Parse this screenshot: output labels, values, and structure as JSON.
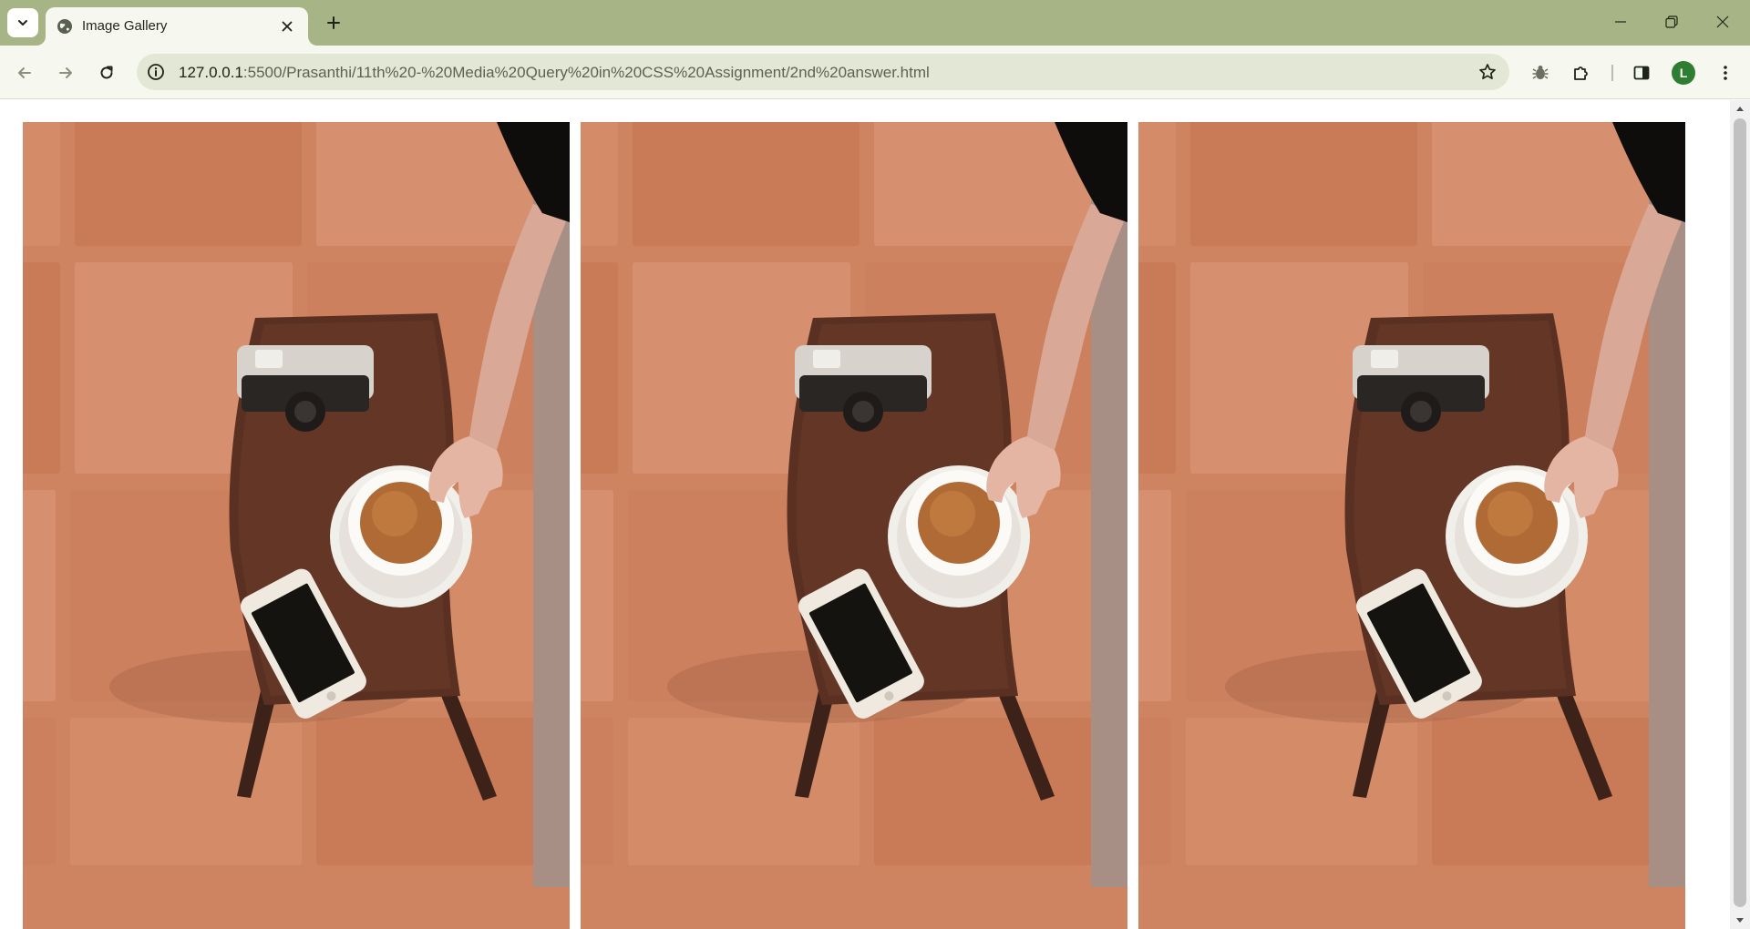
{
  "browser": {
    "tab": {
      "title": "Image Gallery",
      "favicon": "globe-icon"
    },
    "address_bar": {
      "host": "127.0.0.1",
      "rest": ":5500/Prasanthi/11th%20-%20Media%20Query%20in%20CSS%20Assignment/2nd%20answer.html"
    },
    "profile_initial": "L",
    "colors": {
      "frame": "#a7b485",
      "toolbar": "#f6f8ef",
      "omnibox": "#e3e7d6",
      "profile": "#2e7d32"
    }
  },
  "gallery": {
    "images": [
      {
        "subject": "tea-cup-camera-phone-on-stool"
      },
      {
        "subject": "tea-cup-camera-phone-on-stool"
      },
      {
        "subject": "tea-cup-camera-phone-on-stool"
      }
    ]
  }
}
